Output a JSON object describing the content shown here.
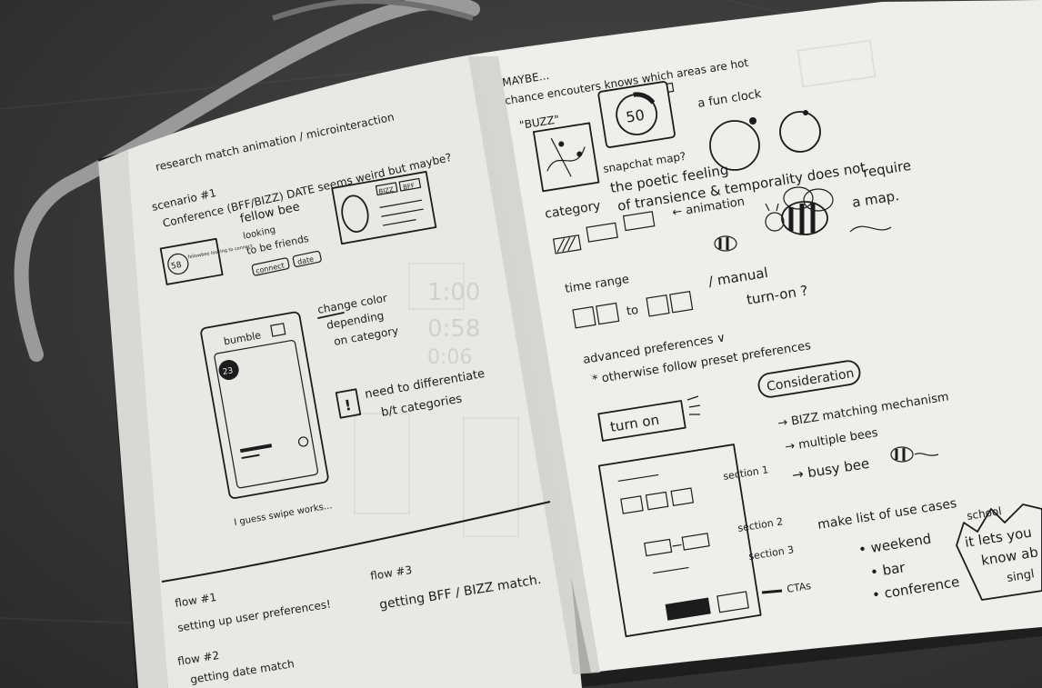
{
  "left_page": {
    "research_note": "research match animation / microinteraction",
    "scenario_heading": "scenario #1",
    "scenario_text": "Conference (BFF/BIZZ) DATE seems weird but maybe?",
    "card_label_1": "BIZZ",
    "card_label_2": "BFF",
    "mini_card_number": "58",
    "mini_card_text": "fellowbee looking to connect",
    "fellow_bee": "fellow bee",
    "looking": "looking",
    "to_be_friends": "to be friends",
    "connect_label": "connect",
    "date_label": "date",
    "phone_brand": "bumble",
    "phone_badge": "23",
    "change_color_line1": "change color",
    "change_color_line2": "depending",
    "change_color_line3": "on category",
    "differentiate_line1": "need to differentiate",
    "differentiate_line2": "b/t categories",
    "swipe_note": "I guess swipe works...",
    "flow1_label": "flow #1",
    "flow1_text": "setting up user preferences!",
    "flow2_label": "flow #2",
    "flow2_text": "getting date match",
    "flow3_label": "flow #3",
    "flow3_text": "getting BFF / BIZZ match."
  },
  "right_page": {
    "maybe": "MAYBE...",
    "chance_note": "chance encouters knows which areas are hot",
    "buzz_label": "\"BUZZ\"",
    "clock_number": "50",
    "fun_clock": "a fun clock",
    "snapchat_map": "snapchat map?",
    "poetic_line1": "the poetic feeling",
    "poetic_line2": "of transience & temporality does not",
    "poetic_line3": "require",
    "poetic_line4": "a map.",
    "category": "category",
    "animation": "← animation",
    "time_range": "time range",
    "to": "to",
    "manual": "/ manual",
    "turn_on_q": "turn-on ?",
    "advanced": "advanced preferences ∨",
    "otherwise": "* otherwise follow preset preferences",
    "consideration": "Consideration",
    "turn_on_button": "turn on",
    "bizz_matching": "→ BIZZ matching mechanism",
    "multiple_bees": "→ multiple bees",
    "busy_bee": "→ busy bee",
    "section1": "section 1",
    "section2": "section 2",
    "section3": "section 3",
    "ctas": "CTAs",
    "use_cases": "make list of use cases",
    "weekend": "• weekend",
    "bar": "• bar",
    "conference": "• conference",
    "school": "school",
    "it_lets": "it lets you",
    "know_about": "know ab",
    "singles": "singl"
  },
  "colors": {
    "paper": "#ecebe8",
    "paper_shadow": "#d6d5d1",
    "ribbon": "#9a9a9a",
    "table": "#3a3a3a",
    "ink": "#1c1c1c"
  }
}
